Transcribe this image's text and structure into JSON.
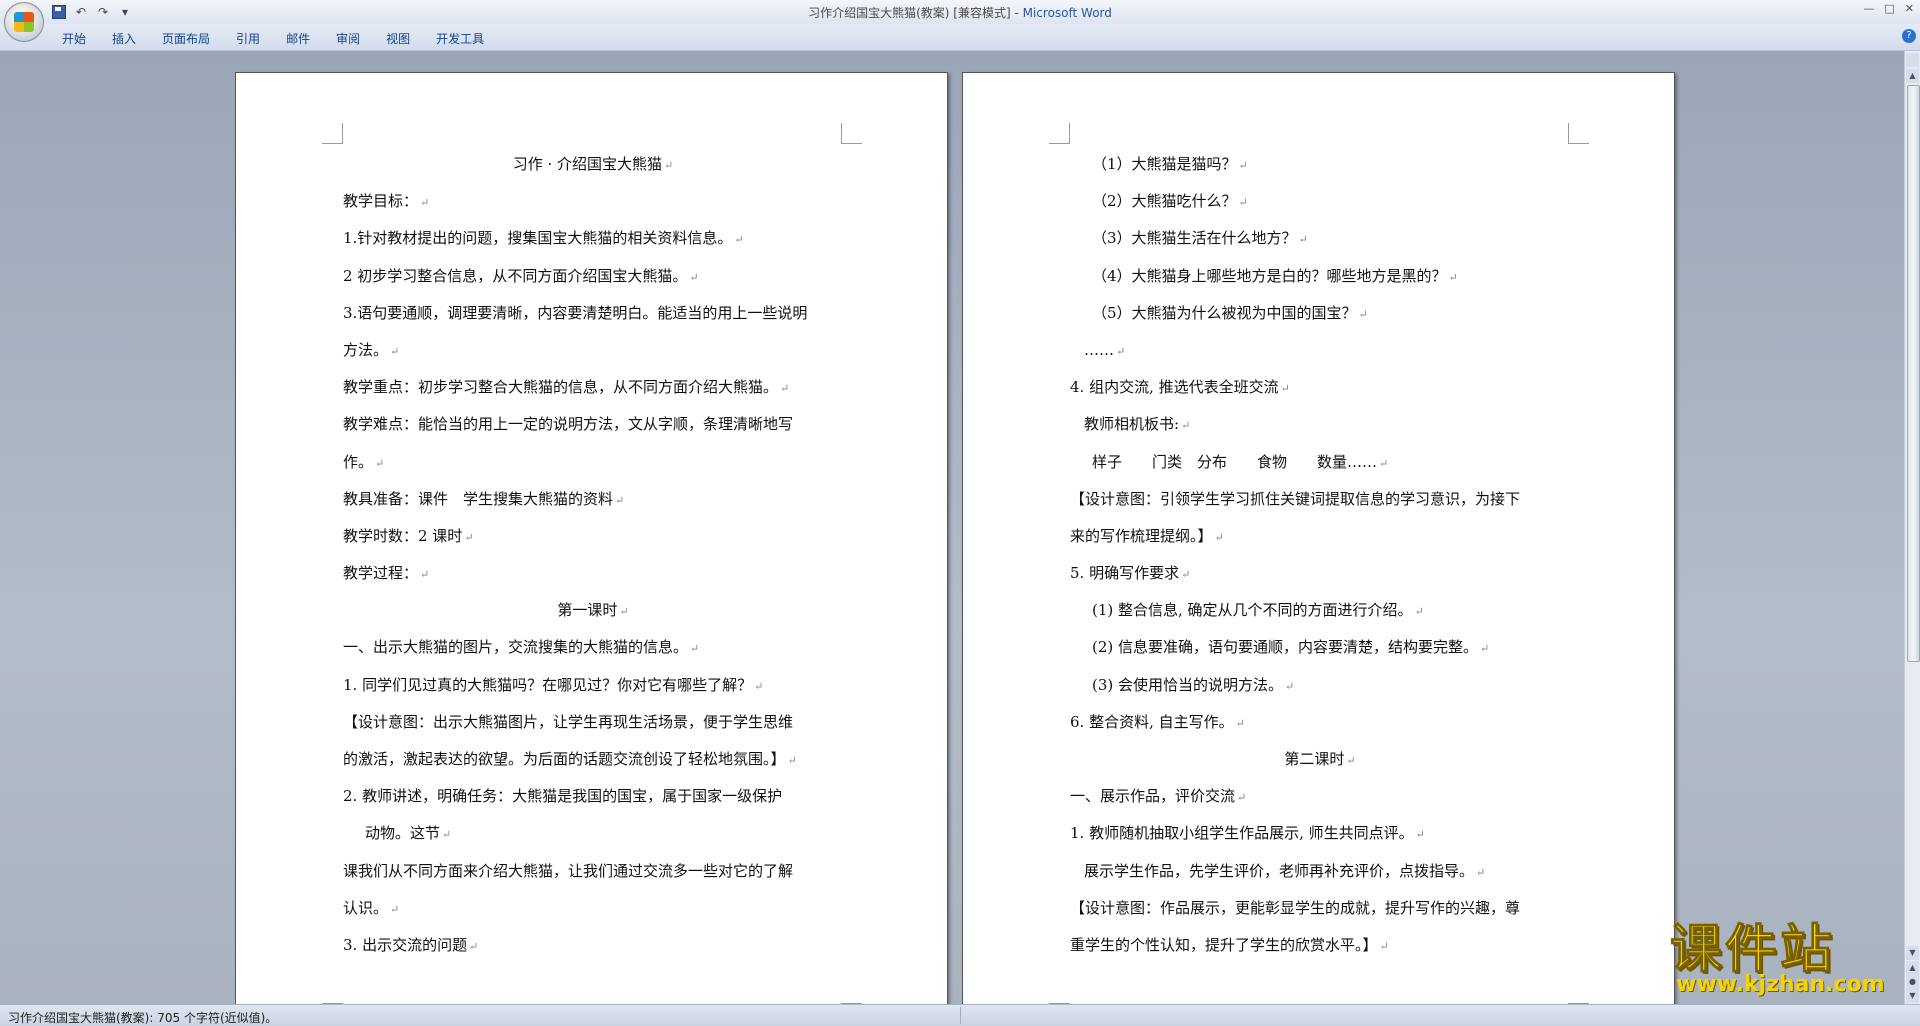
{
  "window": {
    "title": "习作介绍国宝大熊猫(教案) [兼容模式]",
    "separator": " - ",
    "app_name": "Microsoft Word",
    "controls": {
      "minimize": "—",
      "maximize": "□",
      "close": "✕"
    }
  },
  "quick_access": {
    "undo": "↶",
    "redo": "↷",
    "customize": "▾"
  },
  "ribbon": {
    "tabs": [
      "开始",
      "插入",
      "页面布局",
      "引用",
      "邮件",
      "审阅",
      "视图",
      "开发工具"
    ],
    "help": "?"
  },
  "pages": [
    {
      "lines": [
        {
          "text": "习作 · 介绍国宝大熊猫",
          "style": "center"
        },
        {
          "text": "教学目标：",
          "style": ""
        },
        {
          "text": "1.针对教材提出的问题，搜集国宝大熊猫的相关资料信息。",
          "style": ""
        },
        {
          "text": "2 初步学习整合信息，从不同方面介绍国宝大熊猫。",
          "style": ""
        },
        {
          "text": "3.语句要通顺，调理要清晰，内容要清楚明白。能适当的用上一些说明",
          "style": "",
          "nomark": true
        },
        {
          "text": "方法。",
          "style": ""
        },
        {
          "text": "教学重点：初步学习整合大熊猫的信息，从不同方面介绍大熊猫。",
          "style": ""
        },
        {
          "text": "教学难点：能恰当的用上一定的说明方法，文从字顺，条理清晰地写",
          "style": "",
          "nomark": true
        },
        {
          "text": "作。",
          "style": ""
        },
        {
          "text": "教具准备：课件　学生搜集大熊猫的资料",
          "style": ""
        },
        {
          "text": "教学时数：2 课时",
          "style": ""
        },
        {
          "text": "教学过程：",
          "style": ""
        },
        {
          "text": "第一课时",
          "style": "center"
        },
        {
          "text": "一、出示大熊猫的图片，交流搜集的大熊猫的信息。",
          "style": ""
        },
        {
          "text": "1. 同学们见过真的大熊猫吗？在哪见过？你对它有哪些了解？",
          "style": ""
        },
        {
          "text": "【设计意图：出示大熊猫图片，让学生再现生活场景，便于学生思维",
          "style": "",
          "nomark": true
        },
        {
          "text": "的激活，激起表达的欲望。为后面的话题交流创设了轻松地氛围。】",
          "style": ""
        },
        {
          "text": "2. 教师讲述，明确任务：大熊猫是我国的国宝，属于国家一级保护",
          "style": "",
          "nomark": true
        },
        {
          "text": "动物。这节",
          "style": "ind"
        },
        {
          "text": "课我们从不同方面来介绍大熊猫，让我们通过交流多一些对它的了解",
          "style": "",
          "nomark": true
        },
        {
          "text": "认识。",
          "style": ""
        },
        {
          "text": "3. 出示交流的问题",
          "style": ""
        }
      ]
    },
    {
      "lines": [
        {
          "text": "（1）大熊猫是猫吗？",
          "style": "ind"
        },
        {
          "text": "（2）大熊猫吃什么？",
          "style": "ind"
        },
        {
          "text": "（3）大熊猫生活在什么地方？",
          "style": "ind"
        },
        {
          "text": "（4）大熊猫身上哪些地方是白的？哪些地方是黑的？",
          "style": "ind"
        },
        {
          "text": "（5）大熊猫为什么被视为中国的国宝？",
          "style": "ind"
        },
        {
          "text": "……",
          "style": "ind-s"
        },
        {
          "text": "4. 组内交流, 推选代表全班交流",
          "style": ""
        },
        {
          "text": "教师相机板书:",
          "style": "ind-s"
        },
        {
          "text": "样子　　门类　分布　　食物　　数量……",
          "style": "ind"
        },
        {
          "text": "【设计意图：引领学生学习抓住关键词提取信息的学习意识，为接下",
          "style": "",
          "nomark": true
        },
        {
          "text": "来的写作梳理提纲。】",
          "style": ""
        },
        {
          "text": "5. 明确写作要求",
          "style": ""
        },
        {
          "text": "(1) 整合信息, 确定从几个不同的方面进行介绍。",
          "style": "ind"
        },
        {
          "text": "(2) 信息要准确，语句要通顺，内容要清楚，结构要完整。",
          "style": "ind"
        },
        {
          "text": "(3) 会使用恰当的说明方法。",
          "style": "ind"
        },
        {
          "text": "6. 整合资料, 自主写作。",
          "style": ""
        },
        {
          "text": "第二课时",
          "style": "center"
        },
        {
          "text": "一、展示作品，评价交流",
          "style": ""
        },
        {
          "text": "1. 教师随机抽取小组学生作品展示, 师生共同点评。",
          "style": ""
        },
        {
          "text": "展示学生作品，先学生评价，老师再补充评价，点拨指导。",
          "style": "ind-s"
        },
        {
          "text": "【设计意图：作品展示，更能彰显学生的成就，提升写作的兴趣，尊",
          "style": "",
          "nomark": true
        },
        {
          "text": "重学生的个性认知，提升了学生的欣赏水平。】",
          "style": ""
        }
      ]
    }
  ],
  "paragraph_mark": "↵",
  "statusbar": {
    "text": "习作介绍国宝大熊猫(教案): 705 个字符(近似值)。"
  },
  "watermark": {
    "brand": "课件站",
    "url": "www.kjzhan.com"
  }
}
